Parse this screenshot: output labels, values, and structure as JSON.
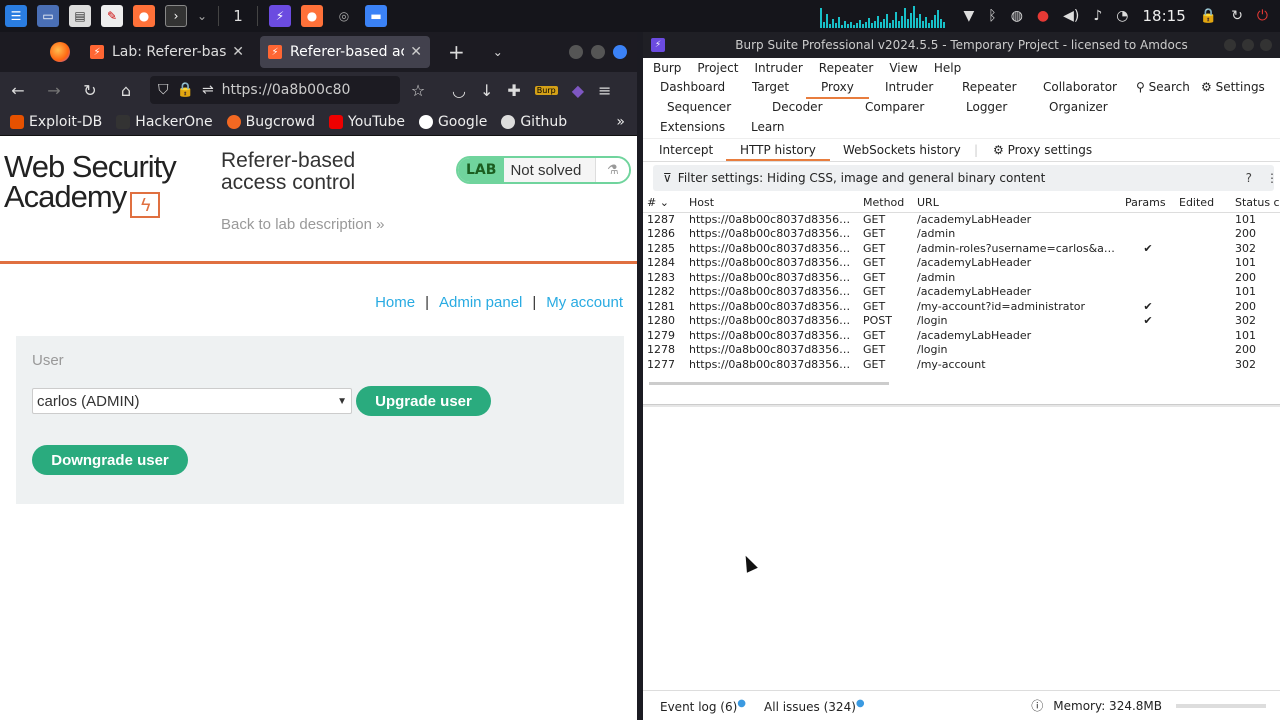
{
  "taskbar": {
    "workspace": "1",
    "clock": "18:15"
  },
  "browser": {
    "tabs": [
      {
        "title": "Lab: Referer-base",
        "active": false
      },
      {
        "title": "Referer-based ac",
        "active": true
      }
    ],
    "url": "https://0a8b00c80",
    "bookmarks": [
      "Exploit-DB",
      "HackerOne",
      "Bugcrowd",
      "YouTube",
      "Google",
      "Github"
    ],
    "extension_badge": "Burp"
  },
  "page": {
    "logo_line1": "Web Security",
    "logo_line2": "Academy",
    "lab_title": "Referer-based access control",
    "back_link": "Back to lab description",
    "back_chevron": "»",
    "badge_lab": "LAB",
    "badge_status": "Not solved",
    "nav": [
      "Home",
      "Admin panel",
      "My account"
    ],
    "nav_sep": "|",
    "user_label": "User",
    "user_select_value": "carlos (ADMIN)",
    "upgrade_button": "Upgrade user",
    "downgrade_button": "Downgrade user"
  },
  "burp": {
    "title": "Burp Suite Professional v2024.5.5 - Temporary Project - licensed to Amdocs",
    "menu": [
      "Burp",
      "Project",
      "Intruder",
      "Repeater",
      "View",
      "Help"
    ],
    "tools_row1": [
      "Dashboard",
      "Target",
      "Proxy",
      "Intruder",
      "Repeater",
      "Collaborator"
    ],
    "tools_row2": [
      "Sequencer",
      "Decoder",
      "Comparer",
      "Logger",
      "Organizer"
    ],
    "tools_row3": [
      "Extensions",
      "Learn"
    ],
    "search_label": "Search",
    "settings_label": "Settings",
    "active_tool": "Proxy",
    "subtabs": [
      "Intercept",
      "HTTP history",
      "WebSockets history"
    ],
    "proxy_settings": "Proxy settings",
    "active_subtab": "HTTP history",
    "filter": "Filter settings: Hiding CSS, image and general binary content",
    "columns": [
      "#",
      "Host",
      "Method",
      "URL",
      "Params",
      "Edited",
      "Status c"
    ],
    "rows": [
      {
        "id": "1287",
        "host": "https://0a8b00c8037d83568...",
        "method": "GET",
        "url": "/academyLabHeader",
        "params": "",
        "status": "101"
      },
      {
        "id": "1286",
        "host": "https://0a8b00c8037d83568...",
        "method": "GET",
        "url": "/admin",
        "params": "",
        "status": "200"
      },
      {
        "id": "1285",
        "host": "https://0a8b00c8037d83568...",
        "method": "GET",
        "url": "/admin-roles?username=carlos&ac...",
        "params": "✔",
        "status": "302"
      },
      {
        "id": "1284",
        "host": "https://0a8b00c8037d83568...",
        "method": "GET",
        "url": "/academyLabHeader",
        "params": "",
        "status": "101"
      },
      {
        "id": "1283",
        "host": "https://0a8b00c8037d83568...",
        "method": "GET",
        "url": "/admin",
        "params": "",
        "status": "200"
      },
      {
        "id": "1282",
        "host": "https://0a8b00c8037d83568...",
        "method": "GET",
        "url": "/academyLabHeader",
        "params": "",
        "status": "101"
      },
      {
        "id": "1281",
        "host": "https://0a8b00c8037d83568...",
        "method": "GET",
        "url": "/my-account?id=administrator",
        "params": "✔",
        "status": "200"
      },
      {
        "id": "1280",
        "host": "https://0a8b00c8037d83568...",
        "method": "POST",
        "url": "/login",
        "params": "✔",
        "status": "302"
      },
      {
        "id": "1279",
        "host": "https://0a8b00c8037d83568...",
        "method": "GET",
        "url": "/academyLabHeader",
        "params": "",
        "status": "101"
      },
      {
        "id": "1278",
        "host": "https://0a8b00c8037d83568...",
        "method": "GET",
        "url": "/login",
        "params": "",
        "status": "200"
      },
      {
        "id": "1277",
        "host": "https://0a8b00c8037d83568...",
        "method": "GET",
        "url": "/my-account",
        "params": "",
        "status": "302"
      }
    ],
    "event_log": "Event log (6)",
    "all_issues": "All issues (324)",
    "memory": "Memory: 324.8MB"
  }
}
